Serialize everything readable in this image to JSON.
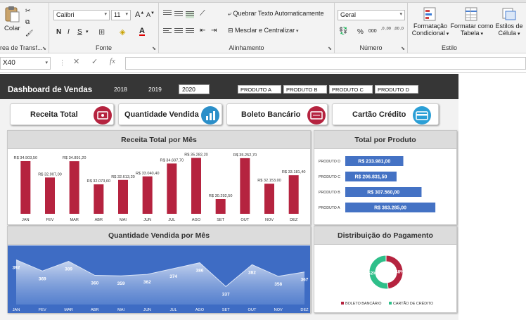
{
  "ribbon": {
    "clipboard": {
      "paste_label": "Colar",
      "group_label": "Área de Transf..."
    },
    "font": {
      "name": "Calibri",
      "size": "11",
      "grow": "A",
      "shrink": "A",
      "bold": "N",
      "italic": "I",
      "underline": "S",
      "group_label": "Fonte"
    },
    "alignment": {
      "wrap_label": "Quebrar Texto Automaticamente",
      "merge_label": "Mesclar e Centralizar",
      "group_label": "Alinhamento"
    },
    "number": {
      "format": "Geral",
      "percent": "%",
      "thousands": "000",
      "dec_up": ",0 ,00",
      "dec_down": ",00 ,0",
      "group_label": "Número"
    },
    "styles": {
      "cond_label_1": "Formatação",
      "cond_label_2": "Condicional",
      "table_label_1": "Formatar como",
      "table_label_2": "Tabela",
      "cell_label_1": "Estilos de",
      "cell_label_2": "Célula",
      "group_label": "Estilo"
    }
  },
  "formula_bar": {
    "name_box": "X40",
    "fx": "fx",
    "value": ""
  },
  "dashboard": {
    "title": "Dashboard de Vendas",
    "years": [
      "2018",
      "2019",
      "2020"
    ],
    "products": [
      "PRODUTO A",
      "PRODUTO B",
      "PRODUTO C",
      "PRODUTO D"
    ],
    "kpis": [
      {
        "label": "Receita Total",
        "color": "#b5233f"
      },
      {
        "label": "Quantidade Vendida",
        "color": "#2b8fc9"
      },
      {
        "label": "Boleto Bancário",
        "color": "#b5233f"
      },
      {
        "label": "Cartão Crédito",
        "color": "#2b9fd6"
      }
    ],
    "panel_titles": {
      "receita": "Receita Total por Mês",
      "produto": "Total por Produto",
      "quantidade": "Quantidade Vendida por Mês",
      "pagamento": "Distribuição do Pagamento"
    },
    "colors": {
      "bar": "#b5233f",
      "hbar": "#4472c4",
      "area_bg": "#3e6cc4",
      "donut_a": "#b5233f",
      "donut_b": "#2fbf8a"
    }
  },
  "chart_data": [
    {
      "type": "bar",
      "title": "Receita Total por Mês",
      "categories": [
        "JAN",
        "FEV",
        "MAR",
        "ABR",
        "MAI",
        "JUN",
        "JUL",
        "AGO",
        "SET",
        "OUT",
        "NOV",
        "DEZ"
      ],
      "values": [
        34903.5,
        32907.0,
        34891.2,
        32073.6,
        32613.2,
        33040.4,
        34607.7,
        35282.2,
        30292.5,
        35252.7,
        32153.0,
        33181.4
      ],
      "labels": [
        "R$ 34.903,50",
        "R$ 32.907,00",
        "R$ 34.891,20",
        "R$ 32.073,60",
        "R$ 32.613,20",
        "R$ 33.040,40",
        "R$ 34.607,70",
        "R$ 35.282,20",
        "R$ 30.292,50",
        "R$ 35.252,70",
        "R$ 32.153,00",
        "R$ 33.181,40"
      ],
      "ylim": [
        28500,
        35500
      ]
    },
    {
      "type": "bar",
      "orientation": "horizontal",
      "title": "Total por Produto",
      "categories": [
        "PRODUTO D",
        "PRODUTO C",
        "PRODUTO B",
        "PRODUTO A"
      ],
      "values": [
        233981.0,
        206831.5,
        307560.0,
        363285.0
      ],
      "labels": [
        "R$ 233.981,00",
        "R$ 206.831,50",
        "R$ 307.560,00",
        "R$ 363.285,00"
      ]
    },
    {
      "type": "area",
      "title": "Quantidade Vendida por Mês",
      "categories": [
        "JAN",
        "FEV",
        "MAR",
        "ABR",
        "MAI",
        "JUN",
        "JUL",
        "AGO",
        "SET",
        "OUT",
        "NOV",
        "DEZ"
      ],
      "values": [
        392,
        369,
        389,
        360,
        359,
        362,
        374,
        386,
        337,
        382,
        358,
        367
      ],
      "ylim": [
        300,
        410
      ]
    },
    {
      "type": "pie",
      "donut": true,
      "title": "Distribuição do Pagamento",
      "categories": [
        "BOLETO BANCÁRIO",
        "CARTÃO DE CRÉDITO"
      ],
      "values": [
        48,
        52
      ],
      "labels": [
        "48%",
        "52%"
      ]
    }
  ]
}
